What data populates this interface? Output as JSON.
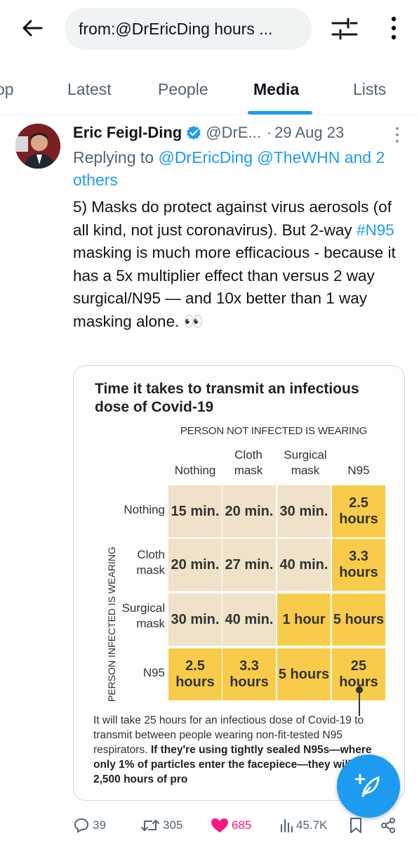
{
  "search": {
    "query": "from:@DrEricDing hours ..."
  },
  "tabs": [
    {
      "label": "op"
    },
    {
      "label": "Latest"
    },
    {
      "label": "People"
    },
    {
      "label": "Media"
    },
    {
      "label": "Lists"
    }
  ],
  "active_tab": "Media",
  "tweet": {
    "author_name": "Eric Feigl-Ding",
    "handle": "@DrE...",
    "date": "29 Aug 23",
    "replying_prefix": "Replying to ",
    "replying_links": "@DrEricDing @TheWHN and 2 others",
    "text_part1": "5) Masks do protect against virus aerosols (of all kind, not just coronavirus). But 2-way ",
    "hashtag": "#N95",
    "text_part2": " masking is much more efficacious - because it has a 5x multiplier effect than versus 2 way surgical/N95 — and 10x better than 1 way masking alone. 👀"
  },
  "infographic": {
    "title": "Time it takes to transmit an infectious dose of Covid-19",
    "top_header": "PERSON NOT INFECTED IS WEARING",
    "side_header": "PERSON INFECTED IS WEARING",
    "columns": [
      "Nothing",
      "Cloth mask",
      "Surgical mask",
      "N95"
    ],
    "rows": [
      {
        "label": "Nothing",
        "cells": [
          {
            "value": "15 min."
          },
          {
            "value": "20 min."
          },
          {
            "value": "30 min."
          },
          {
            "value": "2.5 hours",
            "highlight": true
          }
        ]
      },
      {
        "label": "Cloth mask",
        "cells": [
          {
            "value": "20 min."
          },
          {
            "value": "27 min."
          },
          {
            "value": "40 min."
          },
          {
            "value": "3.3 hours",
            "highlight": true
          }
        ]
      },
      {
        "label": "Surgical mask",
        "cells": [
          {
            "value": "30 min."
          },
          {
            "value": "40 min."
          },
          {
            "value": "1 hour",
            "highlight": true
          },
          {
            "value": "5 hours",
            "highlight": true
          }
        ]
      },
      {
        "label": "N95",
        "cells": [
          {
            "value": "2.5 hours",
            "highlight": true
          },
          {
            "value": "3.3 hours",
            "highlight": true
          },
          {
            "value": "5 hours",
            "highlight": true
          },
          {
            "value": "25 hours",
            "highlight": true
          }
        ]
      }
    ],
    "note_plain": "It will take 25 hours for an infectious dose of Covid-19 to transmit between people wearing non-fit-tested N95 respirators. ",
    "note_bold": "If they're using tightly sealed N95s—where only 1% of particles enter the facepiece—they will have 2,500 hours of pro",
    "colors": {
      "beige": "#efe2c8",
      "yellow": "#f8cc4a"
    }
  },
  "actions": {
    "replies": "39",
    "reposts": "305",
    "likes": "685",
    "views": "45.7K"
  },
  "colors": {
    "accent": "#1d9bf0",
    "like": "#f91880",
    "muted": "#536471"
  }
}
